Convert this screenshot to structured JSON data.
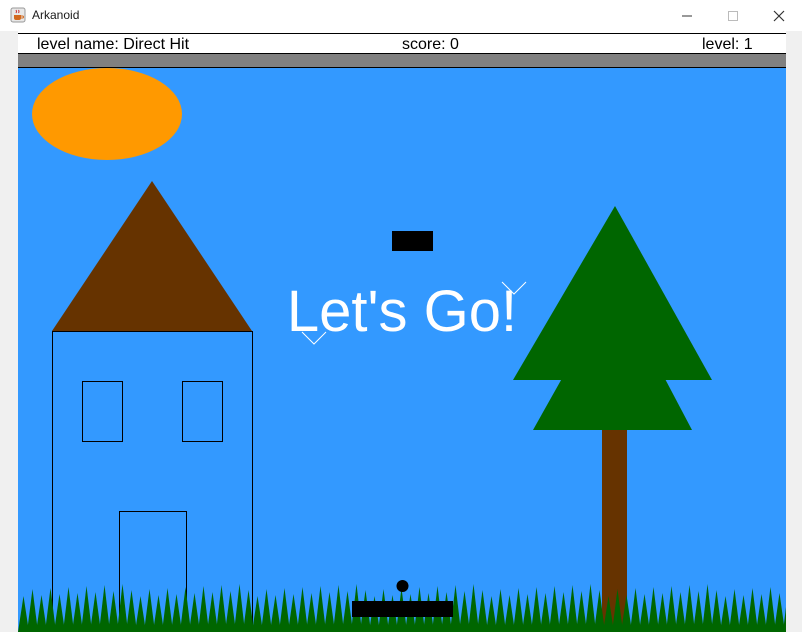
{
  "window": {
    "title": "Arkanoid",
    "icon": "java-cup-icon",
    "controls": [
      "minimize-icon",
      "maximize-icon",
      "close-icon"
    ]
  },
  "hud": {
    "level_name": "level name: Direct Hit",
    "score": "score: 0",
    "level": "level: 1"
  },
  "scene": {
    "overlay_text": "Let's Go!",
    "colors": {
      "sky": "#3399ff",
      "sun": "#ff9900",
      "roof": "#663300",
      "tree_leaves": "#006600",
      "trunk": "#663300",
      "grass": "#006600",
      "block": "#000000",
      "paddle": "#000000",
      "ball": "#000000",
      "overlay_text": "#ffffff",
      "frame_bar": "#808080"
    }
  }
}
